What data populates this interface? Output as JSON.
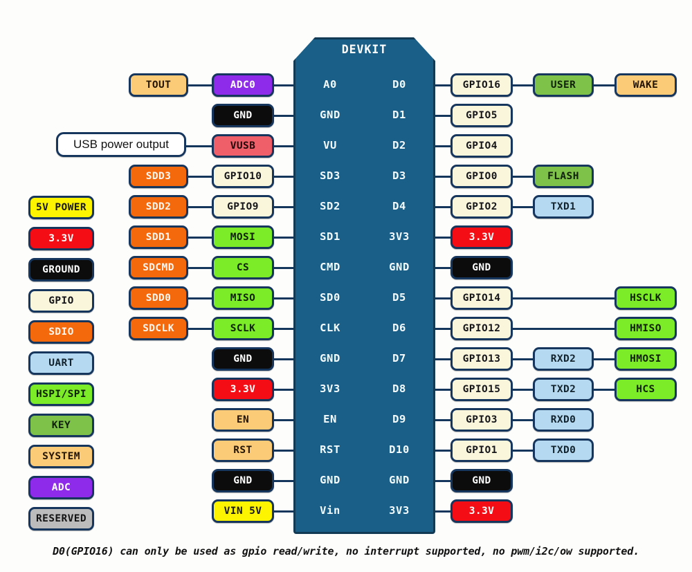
{
  "board": {
    "title": "DEVKIT",
    "left_pins": [
      "A0",
      "GND",
      "VU",
      "SD3",
      "SD2",
      "SD1",
      "CMD",
      "SD0",
      "CLK",
      "GND",
      "3V3",
      "EN",
      "RST",
      "GND",
      "Vin"
    ],
    "right_pins": [
      "D0",
      "D1",
      "D2",
      "D3",
      "D4",
      "3V3",
      "GND",
      "D5",
      "D6",
      "D7",
      "D8",
      "D9",
      "D10",
      "GND",
      "3V3"
    ]
  },
  "legend": {
    "items": [
      {
        "label": "5V POWER",
        "category": "power5v"
      },
      {
        "label": "3.3V",
        "category": "v33"
      },
      {
        "label": "GROUND",
        "category": "ground"
      },
      {
        "label": "GPIO",
        "category": "gpio"
      },
      {
        "label": "SDIO",
        "category": "sdio"
      },
      {
        "label": "UART",
        "category": "uart"
      },
      {
        "label": "HSPI/SPI",
        "category": "hspi"
      },
      {
        "label": "KEY",
        "category": "key"
      },
      {
        "label": "SYSTEM",
        "category": "system"
      },
      {
        "label": "ADC",
        "category": "adc"
      },
      {
        "label": "RESERVED",
        "category": "reserved"
      }
    ]
  },
  "callouts": {
    "usb_power_output": "USB power output"
  },
  "left_side": {
    "outer": [
      {
        "label": "TOUT",
        "category": "system",
        "row": 0
      },
      {
        "label": "SDD3",
        "category": "sdio",
        "row": 3
      },
      {
        "label": "SDD2",
        "category": "sdio",
        "row": 4
      },
      {
        "label": "SDD1",
        "category": "sdio",
        "row": 5
      },
      {
        "label": "SDCMD",
        "category": "sdio",
        "row": 6
      },
      {
        "label": "SDD0",
        "category": "sdio",
        "row": 7
      },
      {
        "label": "SDCLK",
        "category": "sdio",
        "row": 8
      }
    ],
    "inner": [
      {
        "label": "ADC0",
        "category": "adc",
        "row": 0
      },
      {
        "label": "GND",
        "category": "ground",
        "row": 1
      },
      {
        "label": "VUSB",
        "category": "vusb",
        "row": 2
      },
      {
        "label": "GPIO10",
        "category": "gpio",
        "row": 3
      },
      {
        "label": "GPIO9",
        "category": "gpio",
        "row": 4
      },
      {
        "label": "MOSI",
        "category": "hspi",
        "row": 5
      },
      {
        "label": "CS",
        "category": "hspi",
        "row": 6
      },
      {
        "label": "MISO",
        "category": "hspi",
        "row": 7
      },
      {
        "label": "SCLK",
        "category": "hspi",
        "row": 8
      },
      {
        "label": "GND",
        "category": "ground",
        "row": 9
      },
      {
        "label": "3.3V",
        "category": "v33",
        "row": 10
      },
      {
        "label": "EN",
        "category": "system",
        "row": 11
      },
      {
        "label": "RST",
        "category": "system",
        "row": 12
      },
      {
        "label": "GND",
        "category": "ground",
        "row": 13
      },
      {
        "label": "VIN 5V",
        "category": "power5v",
        "row": 14
      }
    ]
  },
  "right_side": {
    "inner": [
      {
        "label": "GPIO16",
        "category": "gpio",
        "row": 0
      },
      {
        "label": "GPIO5",
        "category": "gpio",
        "row": 1
      },
      {
        "label": "GPIO4",
        "category": "gpio",
        "row": 2
      },
      {
        "label": "GPIO0",
        "category": "gpio",
        "row": 3
      },
      {
        "label": "GPIO2",
        "category": "gpio",
        "row": 4
      },
      {
        "label": "3.3V",
        "category": "v33",
        "row": 5
      },
      {
        "label": "GND",
        "category": "ground",
        "row": 6
      },
      {
        "label": "GPIO14",
        "category": "gpio",
        "row": 7
      },
      {
        "label": "GPIO12",
        "category": "gpio",
        "row": 8
      },
      {
        "label": "GPIO13",
        "category": "gpio",
        "row": 9
      },
      {
        "label": "GPIO15",
        "category": "gpio",
        "row": 10
      },
      {
        "label": "GPIO3",
        "category": "gpio",
        "row": 11
      },
      {
        "label": "GPIO1",
        "category": "gpio",
        "row": 12
      },
      {
        "label": "GND",
        "category": "ground",
        "row": 13
      },
      {
        "label": "3.3V",
        "category": "v33",
        "row": 14
      }
    ],
    "middle": [
      {
        "label": "USER",
        "category": "key",
        "row": 0
      },
      {
        "label": "FLASH",
        "category": "key",
        "row": 3
      },
      {
        "label": "TXD1",
        "category": "uart",
        "row": 4
      },
      {
        "label": "RXD2",
        "category": "uart",
        "row": 9
      },
      {
        "label": "TXD2",
        "category": "uart",
        "row": 10
      },
      {
        "label": "RXD0",
        "category": "uart",
        "row": 11
      },
      {
        "label": "TXD0",
        "category": "uart",
        "row": 12
      }
    ],
    "outer": [
      {
        "label": "WAKE",
        "category": "system",
        "row": 0
      },
      {
        "label": "HSCLK",
        "category": "hspi",
        "row": 7
      },
      {
        "label": "HMISO",
        "category": "hspi",
        "row": 8
      },
      {
        "label": "HMOSI",
        "category": "hspi",
        "row": 9
      },
      {
        "label": "HCS",
        "category": "hspi",
        "row": 10
      }
    ]
  },
  "footnote": "D0(GPIO16) can only be used as gpio read/write, no interrupt supported, no pwm/i2c/ow supported.",
  "colors": {
    "board": "#1a5f87",
    "border": "#16365e",
    "power5v": "#fcf400",
    "v33": "#f40d14",
    "ground": "#0c0c0c",
    "gpio": "#faf6dc",
    "sdio": "#f4690c",
    "uart": "#b4d9f0",
    "hspi": "#7ceb28",
    "key": "#7ec24a",
    "system": "#fbcb78",
    "adc": "#8e2bea",
    "reserved": "#bcbcbc",
    "vusb": "#ef5f69"
  }
}
